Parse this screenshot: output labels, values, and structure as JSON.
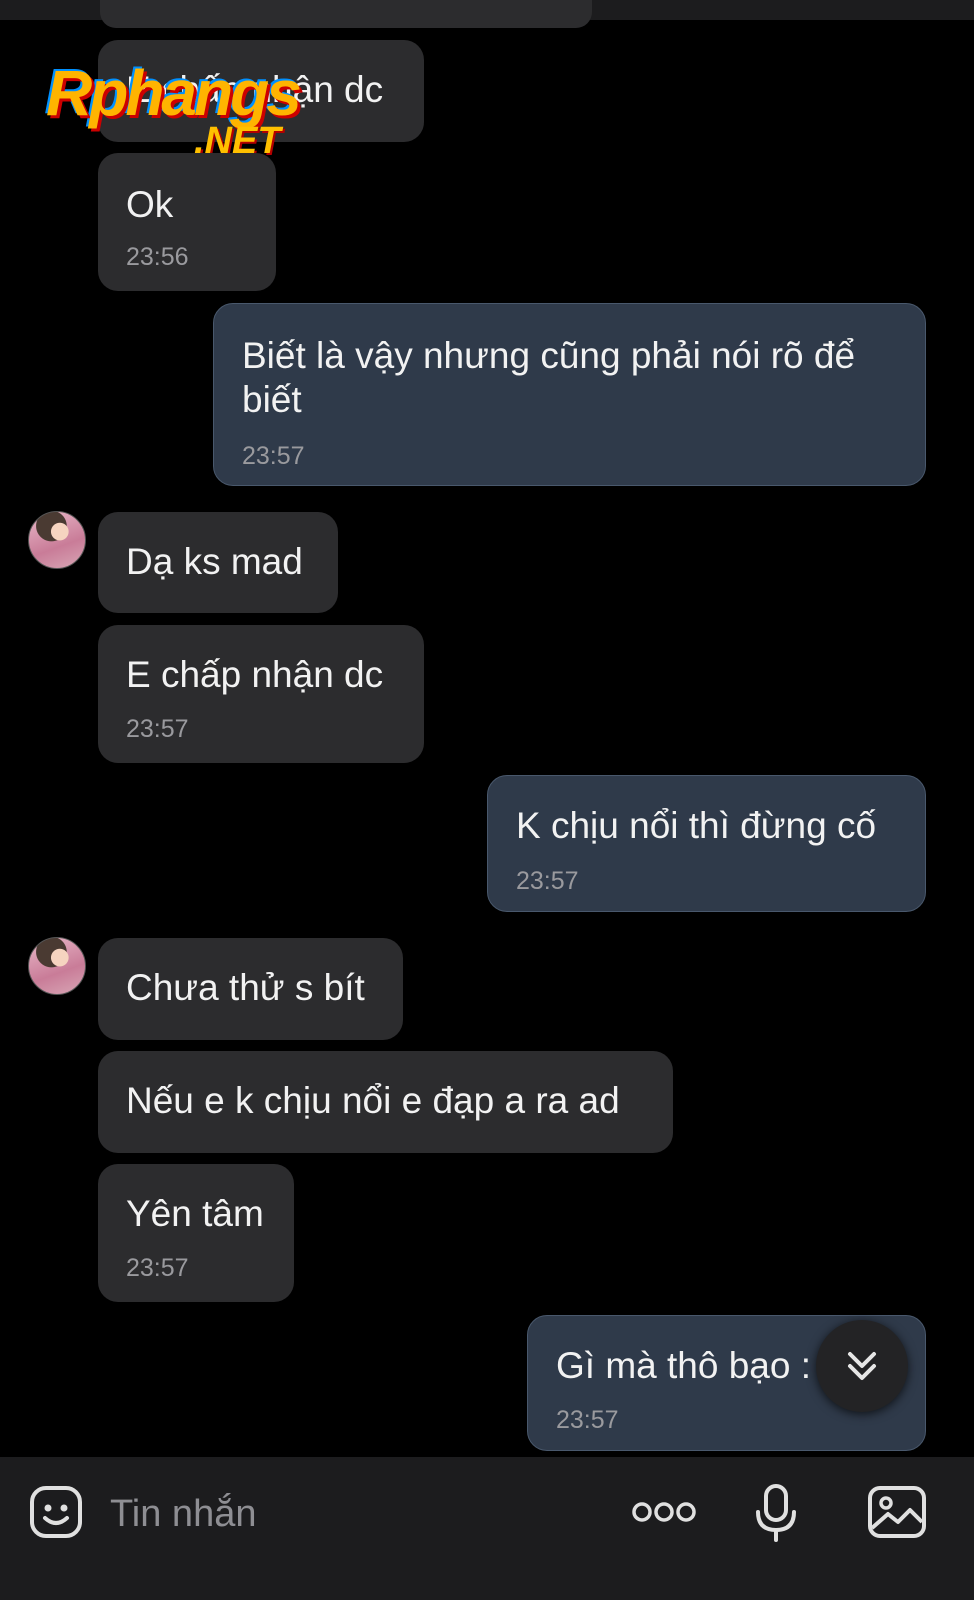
{
  "watermark": {
    "brand": "Rphangs",
    "suffix": ".NET"
  },
  "messages": [
    {
      "side": "them",
      "text": "E chấp nhận dc",
      "time": ""
    },
    {
      "side": "them",
      "text": "Ok",
      "time": "23:56"
    },
    {
      "side": "me",
      "text_line1": "Biết là vậy nhưng cũng phải nói rõ để",
      "text_line2": "biết",
      "time": "23:57"
    },
    {
      "side": "them",
      "text": "Dạ ks mad",
      "time": ""
    },
    {
      "side": "them",
      "text": "E chấp nhận dc",
      "time": "23:57"
    },
    {
      "side": "me",
      "text": "K chịu nổi thì đừng cố",
      "time": "23:57"
    },
    {
      "side": "them",
      "text": "Chưa thử s bít",
      "time": ""
    },
    {
      "side": "them",
      "text": "Nếu e k chịu nổi e đạp a ra ad",
      "time": ""
    },
    {
      "side": "them",
      "text": "Yên tâm",
      "time": "23:57"
    },
    {
      "side": "me",
      "text": "Gì mà thô bạo :",
      "time": "23:57"
    }
  ],
  "input": {
    "placeholder": "Tin nhắn"
  },
  "icons": [
    "sticker-icon",
    "more-dots-icon",
    "microphone-icon",
    "image-icon",
    "scroll-down-icon"
  ]
}
